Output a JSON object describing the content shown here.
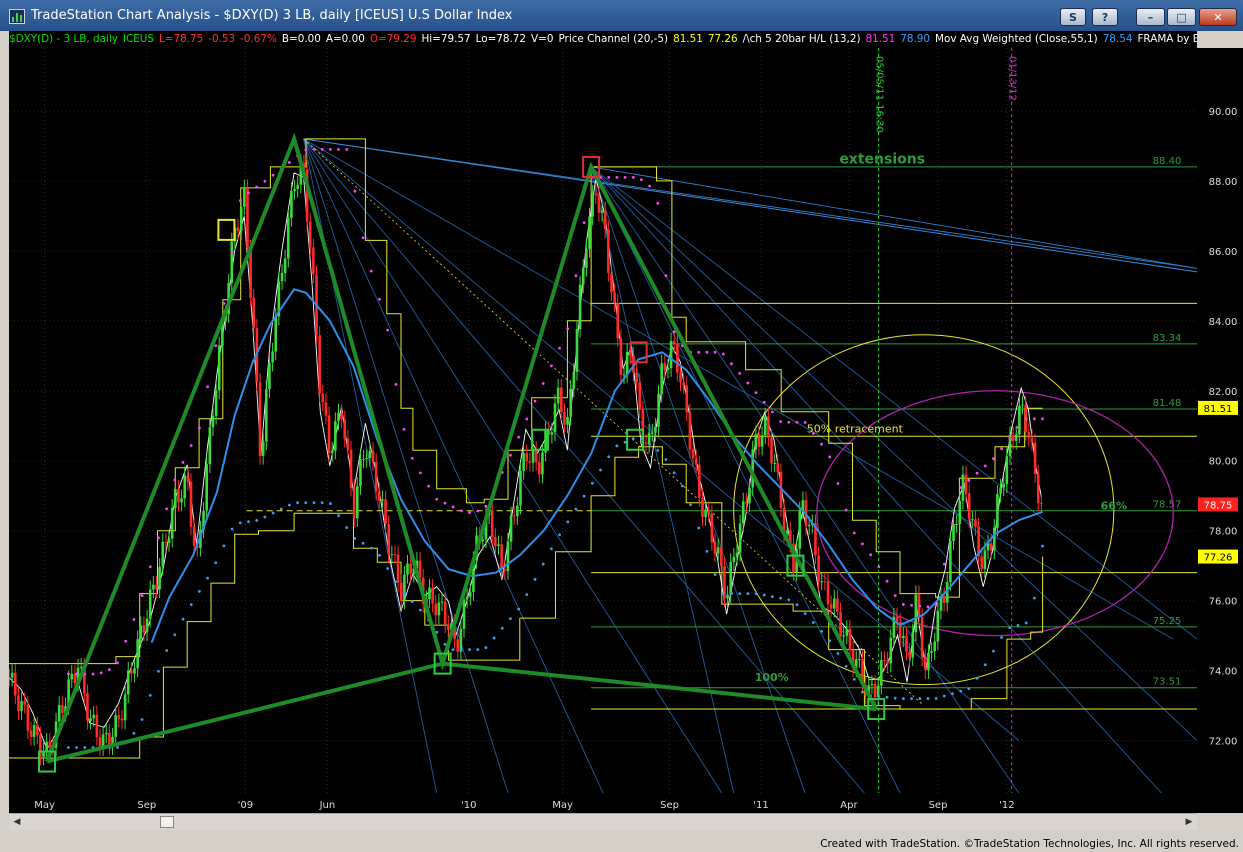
{
  "window": {
    "title": "TradeStation Chart Analysis - $DXY(D) 3 LB, daily [ICEUS] U.S Dollar Index",
    "buttons": [
      "S",
      "?",
      "–",
      "□",
      "✕"
    ]
  },
  "infobar": [
    {
      "text": "$DXY(D) - 3 LB, daily",
      "color": "#00e000"
    },
    {
      "text": "ICEUS",
      "color": "#00e000"
    },
    {
      "text": "L=78.75",
      "color": "#ff3030"
    },
    {
      "text": "-0.53",
      "color": "#ff3030"
    },
    {
      "text": "-0.67%",
      "color": "#ff3030"
    },
    {
      "text": "B=0.00",
      "color": "#ffffff"
    },
    {
      "text": "A=0.00",
      "color": "#ffffff"
    },
    {
      "text": "O=79.29",
      "color": "#ff3030"
    },
    {
      "text": "Hi=79.57",
      "color": "#ffffff"
    },
    {
      "text": "Lo=78.72",
      "color": "#ffffff"
    },
    {
      "text": "V=0",
      "color": "#ffffff"
    },
    {
      "text": "Price Channel (20,-5)",
      "color": "#ffffff"
    },
    {
      "text": "81.51",
      "color": "#ffff00"
    },
    {
      "text": "77.26",
      "color": "#ffff00"
    },
    {
      "text": "/\\ch 5 20bar H/L (13,2)",
      "color": "#ffffff"
    },
    {
      "text": "81.51",
      "color": "#ff33ff"
    },
    {
      "text": "78.90",
      "color": "#30a0ff"
    },
    {
      "text": "Mov Avg Weighted (Close,55,1)",
      "color": "#ffffff"
    },
    {
      "text": "78.54",
      "color": "#30a0ff"
    },
    {
      "text": "FRAMA by Elhers",
      "color": "#ffffff"
    }
  ],
  "credit": "Created with TradeStation. ©TradeStation Technologies, Inc. All rights reserved.",
  "chart_data": {
    "type": "candlestick",
    "title": "$DXY(D) 3 LB, daily [ICEUS] U.S Dollar Index",
    "ylim": [
      70.5,
      91.8
    ],
    "grid": true,
    "y_ticks": [
      72.0,
      74.0,
      76.0,
      78.0,
      80.0,
      82.0,
      84.0,
      86.0,
      88.0,
      90.0
    ],
    "y_tick_labels": [
      "72.00",
      "74.00",
      "76.00",
      "78.00",
      "80.00",
      "82.00",
      "84.00",
      "86.00",
      "88.00",
      "90.00"
    ],
    "x_ticks": [
      "May",
      "Sep",
      "'09",
      "Jun",
      "'10",
      "May",
      "Sep",
      "'11",
      "Apr",
      "Sep",
      "'12"
    ],
    "x_tick_pos": [
      0.03,
      0.116,
      0.199,
      0.268,
      0.387,
      0.466,
      0.556,
      0.633,
      0.707,
      0.782,
      0.84
    ],
    "price_path": [
      [
        0.0,
        73.8
      ],
      [
        0.01,
        73.0
      ],
      [
        0.02,
        72.2
      ],
      [
        0.032,
        71.6
      ],
      [
        0.045,
        73.0
      ],
      [
        0.058,
        74.2
      ],
      [
        0.068,
        72.6
      ],
      [
        0.08,
        71.9
      ],
      [
        0.092,
        72.5
      ],
      [
        0.105,
        74.3
      ],
      [
        0.118,
        75.9
      ],
      [
        0.13,
        77.4
      ],
      [
        0.14,
        78.9
      ],
      [
        0.15,
        79.4
      ],
      [
        0.158,
        77.0
      ],
      [
        0.167,
        80.0
      ],
      [
        0.175,
        82.5
      ],
      [
        0.183,
        84.7
      ],
      [
        0.19,
        86.6
      ],
      [
        0.198,
        87.5
      ],
      [
        0.205,
        84.2
      ],
      [
        0.212,
        80.0
      ],
      [
        0.22,
        83.0
      ],
      [
        0.23,
        85.5
      ],
      [
        0.24,
        88.0
      ],
      [
        0.248,
        88.3
      ],
      [
        0.255,
        85.6
      ],
      [
        0.262,
        82.0
      ],
      [
        0.27,
        80.3
      ],
      [
        0.28,
        81.5
      ],
      [
        0.29,
        78.6
      ],
      [
        0.3,
        80.5
      ],
      [
        0.31,
        79.3
      ],
      [
        0.32,
        77.6
      ],
      [
        0.33,
        76.3
      ],
      [
        0.34,
        77.2
      ],
      [
        0.35,
        76.1
      ],
      [
        0.36,
        75.9
      ],
      [
        0.37,
        75.4
      ],
      [
        0.376,
        74.6
      ],
      [
        0.385,
        76.0
      ],
      [
        0.395,
        77.8
      ],
      [
        0.405,
        78.4
      ],
      [
        0.415,
        76.8
      ],
      [
        0.425,
        78.5
      ],
      [
        0.435,
        80.3
      ],
      [
        0.445,
        79.8
      ],
      [
        0.455,
        80.9
      ],
      [
        0.463,
        81.9
      ],
      [
        0.47,
        80.9
      ],
      [
        0.478,
        83.8
      ],
      [
        0.486,
        86.4
      ],
      [
        0.494,
        87.8
      ],
      [
        0.502,
        86.4
      ],
      [
        0.51,
        84.1
      ],
      [
        0.517,
        82.3
      ],
      [
        0.524,
        83.3
      ],
      [
        0.532,
        80.9
      ],
      [
        0.54,
        80.4
      ],
      [
        0.549,
        82.4
      ],
      [
        0.558,
        83.3
      ],
      [
        0.565,
        82.5
      ],
      [
        0.573,
        80.7
      ],
      [
        0.581,
        79.0
      ],
      [
        0.588,
        78.3
      ],
      [
        0.596,
        77.4
      ],
      [
        0.604,
        76.1
      ],
      [
        0.612,
        77.6
      ],
      [
        0.62,
        78.8
      ],
      [
        0.628,
        80.5
      ],
      [
        0.636,
        81.0
      ],
      [
        0.644,
        80.0
      ],
      [
        0.652,
        78.3
      ],
      [
        0.66,
        77.0
      ],
      [
        0.668,
        78.8
      ],
      [
        0.676,
        77.9
      ],
      [
        0.684,
        76.4
      ],
      [
        0.692,
        76.0
      ],
      [
        0.7,
        75.3
      ],
      [
        0.708,
        74.6
      ],
      [
        0.716,
        74.0
      ],
      [
        0.724,
        73.3
      ],
      [
        0.732,
        73.7
      ],
      [
        0.74,
        74.6
      ],
      [
        0.748,
        75.6
      ],
      [
        0.756,
        74.2
      ],
      [
        0.764,
        76.0
      ],
      [
        0.772,
        73.8
      ],
      [
        0.78,
        75.3
      ],
      [
        0.788,
        76.3
      ],
      [
        0.796,
        78.3
      ],
      [
        0.804,
        79.4
      ],
      [
        0.812,
        78.0
      ],
      [
        0.82,
        77.0
      ],
      [
        0.828,
        77.9
      ],
      [
        0.836,
        79.5
      ],
      [
        0.844,
        80.6
      ],
      [
        0.852,
        81.5
      ],
      [
        0.858,
        80.9
      ],
      [
        0.864,
        79.5
      ],
      [
        0.869,
        78.75
      ]
    ],
    "channel_high": [
      [
        0.0,
        74.2
      ],
      [
        0.03,
        74.2
      ],
      [
        0.075,
        74.2
      ],
      [
        0.09,
        74.4
      ],
      [
        0.11,
        76.2
      ],
      [
        0.125,
        78.0
      ],
      [
        0.14,
        79.8
      ],
      [
        0.16,
        81.2
      ],
      [
        0.18,
        84.6
      ],
      [
        0.195,
        87.8
      ],
      [
        0.22,
        88.4
      ],
      [
        0.25,
        89.2
      ],
      [
        0.285,
        89.2
      ],
      [
        0.3,
        86.3
      ],
      [
        0.318,
        84.2
      ],
      [
        0.33,
        81.5
      ],
      [
        0.34,
        80.3
      ],
      [
        0.36,
        79.2
      ],
      [
        0.385,
        78.8
      ],
      [
        0.4,
        78.9
      ],
      [
        0.42,
        80.3
      ],
      [
        0.44,
        81.8
      ],
      [
        0.47,
        84.0
      ],
      [
        0.49,
        88.4
      ],
      [
        0.53,
        88.4
      ],
      [
        0.545,
        88.0
      ],
      [
        0.558,
        84.1
      ],
      [
        0.57,
        83.4
      ],
      [
        0.6,
        83.4
      ],
      [
        0.62,
        82.6
      ],
      [
        0.65,
        81.4
      ],
      [
        0.67,
        81.4
      ],
      [
        0.69,
        80.5
      ],
      [
        0.71,
        78.3
      ],
      [
        0.73,
        77.4
      ],
      [
        0.75,
        76.2
      ],
      [
        0.78,
        76.1
      ],
      [
        0.8,
        79.5
      ],
      [
        0.83,
        80.4
      ],
      [
        0.855,
        81.5
      ],
      [
        0.87,
        81.5
      ]
    ],
    "channel_low": [
      [
        0.0,
        71.5
      ],
      [
        0.07,
        71.5
      ],
      [
        0.095,
        71.5
      ],
      [
        0.11,
        72.1
      ],
      [
        0.13,
        74.1
      ],
      [
        0.15,
        75.4
      ],
      [
        0.17,
        76.5
      ],
      [
        0.19,
        77.9
      ],
      [
        0.21,
        78.0
      ],
      [
        0.24,
        78.5
      ],
      [
        0.27,
        78.5
      ],
      [
        0.29,
        77.5
      ],
      [
        0.31,
        77.1
      ],
      [
        0.33,
        76.0
      ],
      [
        0.35,
        75.3
      ],
      [
        0.37,
        74.3
      ],
      [
        0.4,
        74.3
      ],
      [
        0.43,
        75.5
      ],
      [
        0.46,
        77.4
      ],
      [
        0.49,
        79.0
      ],
      [
        0.51,
        80.1
      ],
      [
        0.53,
        80.4
      ],
      [
        0.55,
        79.9
      ],
      [
        0.57,
        78.8
      ],
      [
        0.6,
        75.9
      ],
      [
        0.63,
        75.9
      ],
      [
        0.66,
        75.7
      ],
      [
        0.69,
        74.6
      ],
      [
        0.72,
        73.0
      ],
      [
        0.75,
        72.9
      ],
      [
        0.78,
        72.9
      ],
      [
        0.81,
        73.2
      ],
      [
        0.84,
        74.9
      ],
      [
        0.86,
        75.1
      ],
      [
        0.87,
        77.26
      ]
    ],
    "wma_path": [
      [
        0.12,
        74.8
      ],
      [
        0.135,
        76.1
      ],
      [
        0.155,
        77.3
      ],
      [
        0.175,
        79.1
      ],
      [
        0.19,
        81.3
      ],
      [
        0.205,
        82.8
      ],
      [
        0.22,
        83.9
      ],
      [
        0.24,
        84.9
      ],
      [
        0.25,
        84.8
      ],
      [
        0.27,
        84.0
      ],
      [
        0.29,
        82.7
      ],
      [
        0.31,
        80.6
      ],
      [
        0.33,
        78.9
      ],
      [
        0.35,
        77.7
      ],
      [
        0.37,
        76.9
      ],
      [
        0.39,
        76.7
      ],
      [
        0.41,
        76.8
      ],
      [
        0.43,
        77.3
      ],
      [
        0.45,
        78.0
      ],
      [
        0.47,
        79.0
      ],
      [
        0.49,
        80.2
      ],
      [
        0.51,
        82.0
      ],
      [
        0.53,
        82.9
      ],
      [
        0.55,
        83.1
      ],
      [
        0.57,
        82.6
      ],
      [
        0.59,
        81.7
      ],
      [
        0.61,
        80.7
      ],
      [
        0.63,
        79.9
      ],
      [
        0.65,
        79.2
      ],
      [
        0.67,
        78.5
      ],
      [
        0.69,
        77.6
      ],
      [
        0.71,
        76.6
      ],
      [
        0.73,
        75.8
      ],
      [
        0.75,
        75.3
      ],
      [
        0.77,
        75.6
      ],
      [
        0.79,
        76.3
      ],
      [
        0.81,
        77.1
      ],
      [
        0.83,
        77.9
      ],
      [
        0.85,
        78.3
      ],
      [
        0.87,
        78.54
      ]
    ],
    "horizontal_levels": [
      {
        "value": 88.4,
        "label": "88.40",
        "color": "#2e9c3a",
        "x0": 0.49
      },
      {
        "value": 84.5,
        "label": "",
        "color": "#e6e62e",
        "x0": 0.49
      },
      {
        "value": 83.34,
        "label": "83.34",
        "color": "#2e9c3a",
        "x0": 0.49
      },
      {
        "value": 81.48,
        "label": "81.48",
        "color": "#2e9c3a",
        "x0": 0.49
      },
      {
        "value": 80.7,
        "label": "",
        "color": "#e6e62e",
        "x0": 0.49
      },
      {
        "value": 78.57,
        "label": "78.57",
        "color": "#2e9c3a",
        "x0": 0.49
      },
      {
        "value": 76.8,
        "label": "",
        "color": "#e6e62e",
        "x0": 0.49
      },
      {
        "value": 75.25,
        "label": "75.25",
        "color": "#2e9c3a",
        "x0": 0.49
      },
      {
        "value": 73.51,
        "label": "73.51",
        "color": "#2e9c3a",
        "x0": 0.49
      },
      {
        "value": 72.9,
        "label": "",
        "color": "#e6e62e",
        "x0": 0.49
      }
    ],
    "zigzag": [
      [
        0.032,
        71.4
      ],
      [
        0.24,
        89.2
      ],
      [
        0.365,
        74.2
      ],
      [
        0.49,
        88.4
      ],
      [
        0.73,
        72.9
      ]
    ],
    "zigzag_lower": [
      [
        0.032,
        71.4
      ],
      [
        0.365,
        74.2
      ],
      [
        0.73,
        72.9
      ]
    ],
    "annotations": [
      {
        "text": "extensions",
        "x": 0.735,
        "y": 88.5,
        "color": "#2e9c3a"
      },
      {
        "text": "50% retracement",
        "x": 0.712,
        "y": 80.8,
        "color": "#e6e62e"
      },
      {
        "text": "66%",
        "x": 0.93,
        "y": 78.6,
        "color": "#2e9c3a"
      },
      {
        "text": "100%",
        "x": 0.642,
        "y": 73.7,
        "color": "#2e9c3a"
      }
    ],
    "vertical_markers": [
      {
        "x": 0.732,
        "label": "05/05/11 16:30",
        "color": "#2ecc40"
      },
      {
        "x": 0.844,
        "label": "01/13/12",
        "color": "#cc33cc"
      }
    ],
    "price_flags": [
      {
        "value": 81.51,
        "label": "81.51",
        "bg": "#ffff00",
        "fg": "#000"
      },
      {
        "value": 78.75,
        "label": "78.75",
        "bg": "#ff2020",
        "fg": "#fff"
      },
      {
        "value": 77.26,
        "label": "77.26",
        "bg": "#ffff00",
        "fg": "#000"
      }
    ]
  }
}
